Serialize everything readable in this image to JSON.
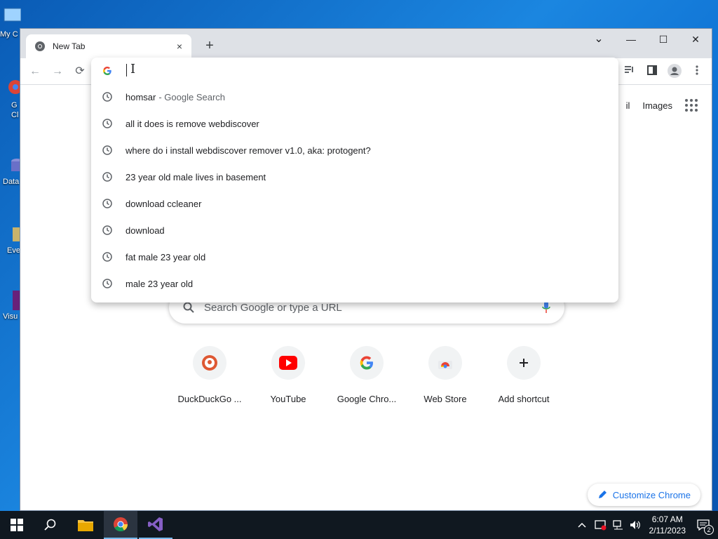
{
  "desktop": {
    "icons": [
      {
        "label": "My C",
        "icon": "computer-icon"
      },
      {
        "label": "G Cl",
        "icon": "google-chrome-shortcut-icon"
      },
      {
        "label": "Data",
        "icon": "database-shortcut-icon"
      },
      {
        "label": "Eve",
        "icon": "event-viewer-shortcut-icon"
      },
      {
        "label": "Visu",
        "icon": "visual-studio-shortcut-icon"
      }
    ]
  },
  "browser": {
    "tab": {
      "title": "New Tab",
      "close": "×"
    },
    "new_tab": "+",
    "window_controls": {
      "menu": "⌄",
      "minimize": "—",
      "maximize": "☐",
      "close": "✕"
    },
    "nav": {
      "back": "←",
      "forward": "→",
      "reload": "⟳"
    },
    "omnibox": {
      "value": "",
      "suggestions": [
        {
          "text": "homsar",
          "suffix": "- Google Search"
        },
        {
          "text": "all it does is remove webdiscover",
          "suffix": ""
        },
        {
          "text": "where do i install webdiscover remover v1.0, aka: protogent?",
          "suffix": ""
        },
        {
          "text": "23 year old male lives in basement",
          "suffix": ""
        },
        {
          "text": "download ccleaner",
          "suffix": ""
        },
        {
          "text": "download",
          "suffix": ""
        },
        {
          "text": "fat male 23 year old",
          "suffix": ""
        },
        {
          "text": "male 23 year old",
          "suffix": ""
        }
      ]
    },
    "ntp": {
      "gmail_partial": "il",
      "images": "Images",
      "search_placeholder": "Search Google or type a URL",
      "shortcuts": [
        {
          "label": "DuckDuckGo ...",
          "icon": "duckduckgo-icon"
        },
        {
          "label": "YouTube",
          "icon": "youtube-icon"
        },
        {
          "label": "Google Chro...",
          "icon": "google-icon"
        },
        {
          "label": "Web Store",
          "icon": "webstore-icon"
        },
        {
          "label": "Add shortcut",
          "icon": "plus-icon"
        }
      ],
      "customize": "Customize Chrome"
    }
  },
  "taskbar": {
    "time": "6:07 AM",
    "date": "2/11/2023",
    "notifications": "2"
  },
  "colors": {
    "accent": "#1a73e8",
    "taskbar": "#101820",
    "tabstrip": "#dee1e6"
  }
}
